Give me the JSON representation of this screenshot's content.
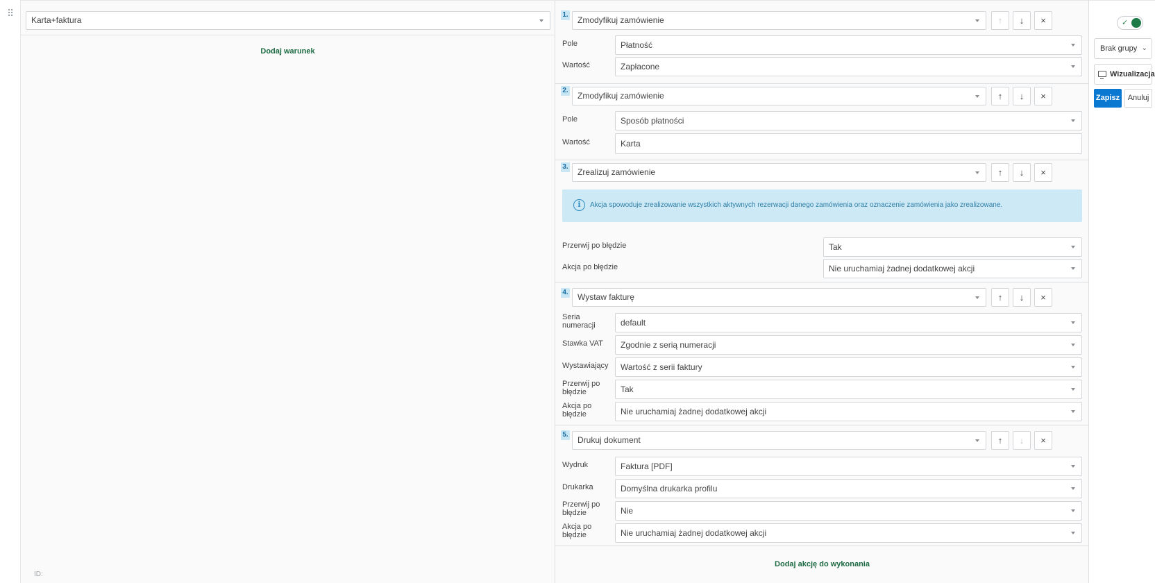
{
  "condition": {
    "select_value": "Karta+faktura",
    "add_condition_label": "Dodaj warunek",
    "id_label": "ID:"
  },
  "actions": [
    {
      "number": "1.",
      "type": "Zmodyfikuj zamówienie",
      "fields": [
        {
          "label": "Pole",
          "value": "Płatność",
          "kind": "select"
        },
        {
          "label": "Wartość",
          "value": "Zapłacone",
          "kind": "select"
        }
      ]
    },
    {
      "number": "2.",
      "type": "Zmodyfikuj zamówienie",
      "fields": [
        {
          "label": "Pole",
          "value": "Sposób płatności",
          "kind": "select"
        },
        {
          "label": "Wartość",
          "value": "Karta",
          "kind": "input"
        }
      ]
    },
    {
      "number": "3.",
      "type": "Zrealizuj zamówienie",
      "info": "Akcja spowoduje zrealizowanie wszystkich aktywnych rezerwacji danego zamówienia oraz oznaczenie zamówienia jako zrealizowane.",
      "fields": [
        {
          "label": "Przerwij po błędzie",
          "value": "Tak",
          "kind": "select"
        },
        {
          "label": "Akcja po błędzie",
          "value": "Nie uruchamiaj żadnej dodatkowej akcji",
          "kind": "select"
        }
      ]
    },
    {
      "number": "4.",
      "type": "Wystaw fakturę",
      "fields": [
        {
          "label_line1": "Seria",
          "label_line2": "numeracji",
          "value": "default",
          "kind": "select"
        },
        {
          "label": "Stawka VAT",
          "value": "Zgodnie z serią numeracji",
          "kind": "select"
        },
        {
          "label": "Wystawiający",
          "value": "Wartość z serii faktury",
          "kind": "select"
        },
        {
          "label_line1": "Przerwij po",
          "label_line2": "błędzie",
          "value": "Tak",
          "kind": "select"
        },
        {
          "label_line1": "Akcja po",
          "label_line2": "błędzie",
          "value": "Nie uruchamiaj żadnej dodatkowej akcji",
          "kind": "select"
        }
      ]
    },
    {
      "number": "5.",
      "type": "Drukuj dokument",
      "fields": [
        {
          "label": "Wydruk",
          "value": "Faktura [PDF]",
          "kind": "select"
        },
        {
          "label": "Drukarka",
          "value": "Domyślna drukarka profilu",
          "kind": "select"
        },
        {
          "label_line1": "Przerwij po",
          "label_line2": "błędzie",
          "value": "Nie",
          "kind": "select"
        },
        {
          "label_line1": "Akcja po",
          "label_line2": "błędzie",
          "value": "Nie uruchamiaj żadnej dodatkowej akcji",
          "kind": "select"
        }
      ]
    }
  ],
  "buttons": {
    "move_up_icon": "↑",
    "move_down_icon": "↓",
    "remove_icon": "×",
    "add_action_label": "Dodaj akcję do wykonania"
  },
  "sidebar": {
    "toggle_on": true,
    "toggle_check": "✓",
    "group_select_value": "Brak grupy",
    "group_chevron": "⌄",
    "visualization_label": "Wizualizacja",
    "save_label": "Zapisz",
    "cancel_label": "Anuluj"
  },
  "drag_handle_glyph": "⠿",
  "colors": {
    "primary_button": "#0a78d1",
    "link_green": "#1d6b43",
    "toggle_knob": "#1e7a46",
    "info_background": "#cde9f5",
    "step_badge_background": "#c9e6f5"
  }
}
